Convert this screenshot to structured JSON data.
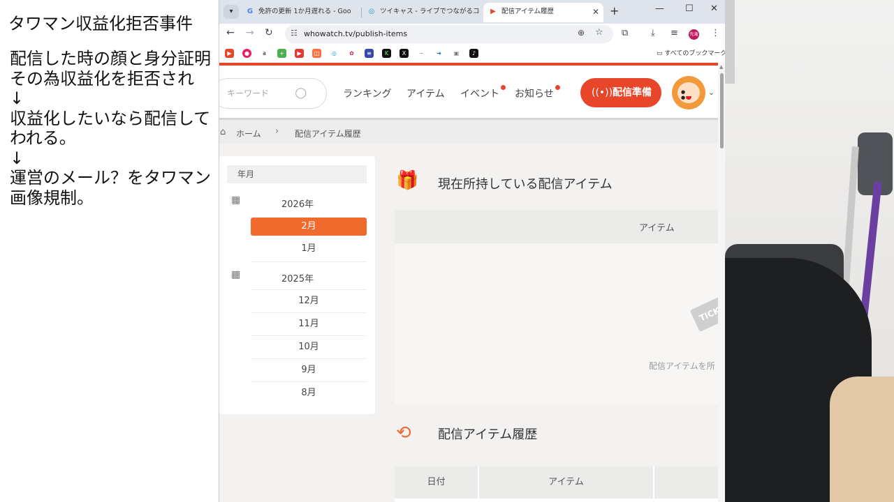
{
  "caption": {
    "title": "タワマン収益化拒否事件",
    "lines": [
      "配信した時の顔と身分証明",
      "その為収益化を拒否され",
      "↓",
      "収益化したいなら配信して",
      "われる。",
      "↓",
      "運営のメール？をタワマン",
      "画像規制。"
    ]
  },
  "browser": {
    "tabs": [
      {
        "label": "免許の更新 1か月遅れる - Goo",
        "icon": "G"
      },
      {
        "label": "ツイキャス - ライブでつながるコミュ",
        "icon": "◎"
      },
      {
        "label": "配信アイテム履歴",
        "icon": "▶"
      }
    ],
    "url": "whowatch.tv/publish-items",
    "profile_label": "先滝",
    "bookmarks_folder": "すべてのブックマーク"
  },
  "site": {
    "search_placeholder": "キーワード",
    "nav": [
      "ランキング",
      "アイテム",
      "イベント",
      "お知らせ"
    ],
    "live_button": "配信準備",
    "breadcrumb": {
      "home": "ホーム",
      "current": "配信アイテム履歴"
    }
  },
  "sidebar": {
    "header": "年月",
    "years": [
      {
        "label": "2026年",
        "months": [
          "2月",
          "1月"
        ],
        "selected": "2月"
      },
      {
        "label": "2025年",
        "months": [
          "12月",
          "11月",
          "10月",
          "9月",
          "8月"
        ]
      }
    ]
  },
  "main": {
    "current_title": "現在所持している配信アイテム",
    "current_table_header": "アイテム",
    "ticket_text": "TICK",
    "empty_text": "配信アイテムを所",
    "history_title": "配信アイテム履歴",
    "history_headers": [
      "日付",
      "アイテム"
    ]
  },
  "colors": {
    "accent": "#e8462a",
    "selected_month": "#f16b2e"
  }
}
